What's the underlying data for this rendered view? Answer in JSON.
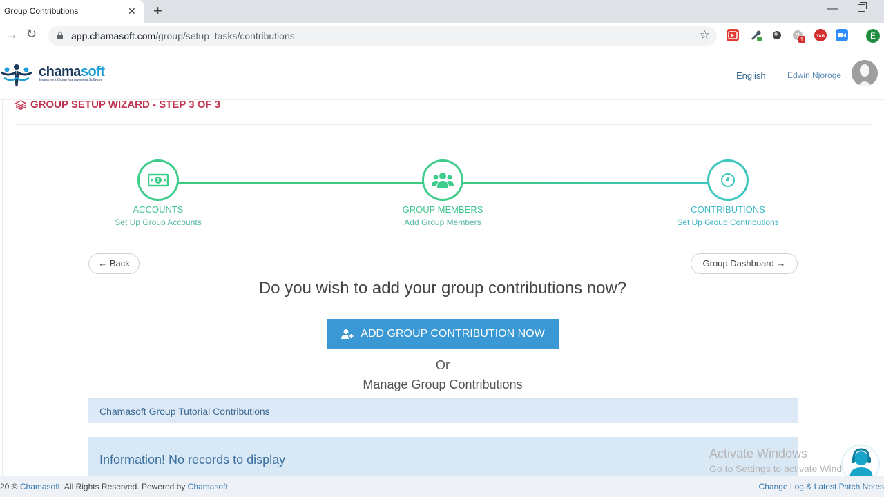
{
  "browser": {
    "tab_title": "Group Contributions",
    "tab_close": "✕",
    "new_tab": "+",
    "url_host": "app.chamasoft.com",
    "url_path": "/group/setup_tasks/contributions",
    "profile_initial": "E",
    "extensions": [
      "video-ext-icon",
      "eyedropper-ext-icon",
      "dark-circle-ext-icon",
      "help-ext-icon",
      "yab-ext-icon",
      "zoom-ext-icon"
    ],
    "extension_badge": "1",
    "yab_label": "YAB"
  },
  "header": {
    "logo_primary": "chama",
    "logo_secondary": "soft",
    "logo_tagline": "Investment Group Management Software",
    "language": "English",
    "user_name": "Edwin Njoroge"
  },
  "wizard": {
    "title": "GROUP SETUP WIZARD - STEP 3 OF 3",
    "steps": [
      {
        "title": "ACCOUNTS",
        "subtitle": "Set Up Group Accounts",
        "icon": "money-icon"
      },
      {
        "title": "GROUP MEMBERS",
        "subtitle": "Add Group Members",
        "icon": "users-icon"
      },
      {
        "title": "CONTRIBUTIONS",
        "subtitle": "Set Up Group Contributions",
        "icon": "clock-icon"
      }
    ],
    "back_label": "← Back",
    "dashboard_label": "Group Dashboard →",
    "question": "Do you wish to add your group contributions now?",
    "cta_label": "ADD GROUP CONTRIBUTION NOW",
    "or_text": "Or",
    "manage_text": "Manage Group Contributions"
  },
  "panel": {
    "title": "Chamasoft Group Tutorial Contributions",
    "info": "Information! No records to display"
  },
  "watermark": {
    "line1": "Activate Windows",
    "line2": "Go to Settings to activate Windows."
  },
  "footer": {
    "copyright_prefix": "20 © ",
    "brand": "Chamasoft",
    "copyright_middle": ".  All Rights Reserved. Powered by ",
    "powered_by": "Chamasoft",
    "changelog": "Change Log & Latest Patch Notes"
  },
  "colors": {
    "accent_red": "#c0344f",
    "step_green": "#3dcc8a",
    "step_teal": "#3cc6be",
    "cta_blue": "#3a98d4"
  }
}
